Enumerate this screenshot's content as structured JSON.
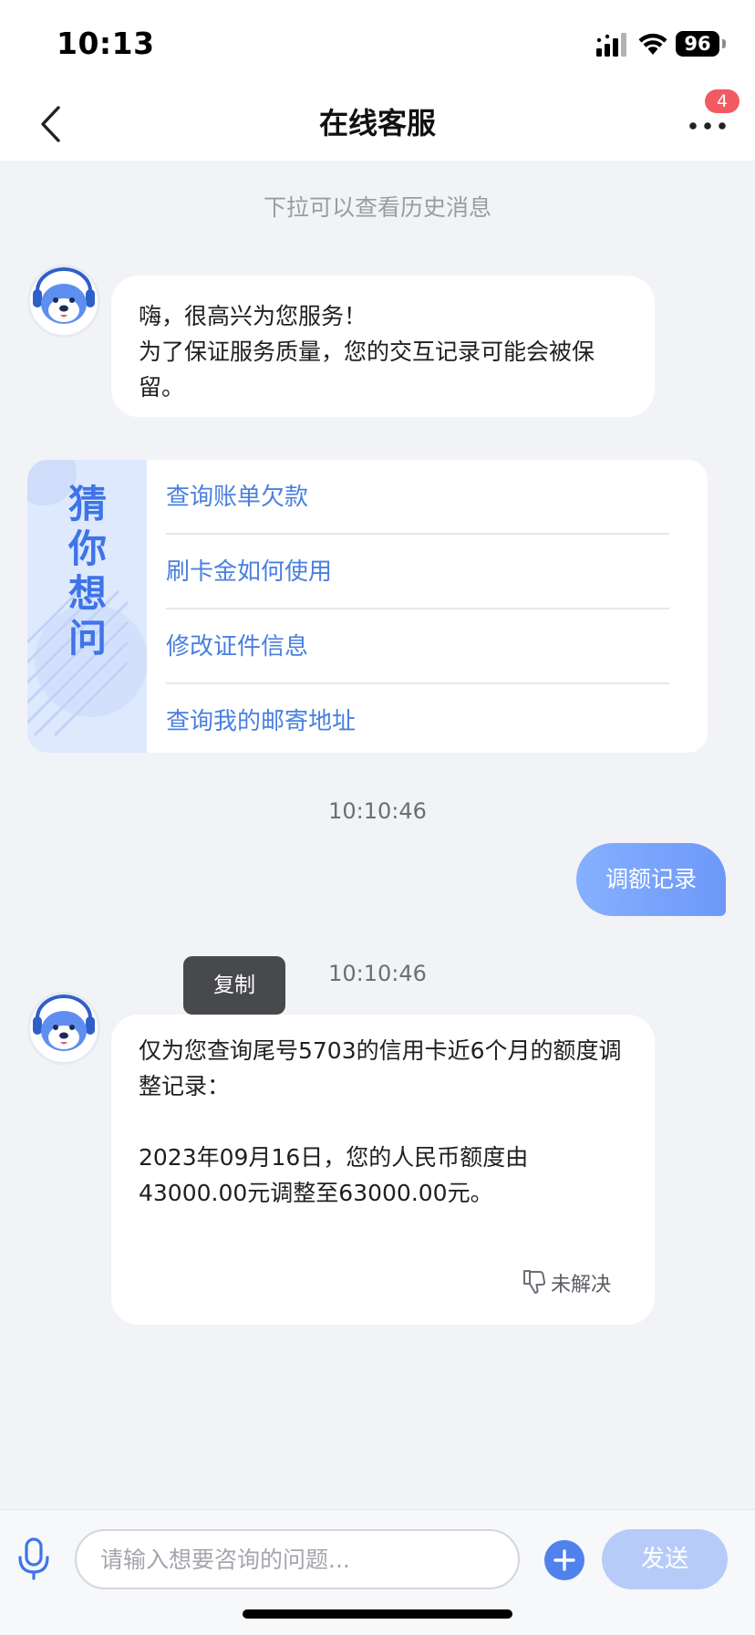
{
  "status_bar": {
    "time": "10:13",
    "battery": "96"
  },
  "header": {
    "title": "在线客服",
    "badge_count": "4"
  },
  "history_hint": "下拉可以查看历史消息",
  "welcome_message": {
    "text": "嗨，很高兴为您服务！\n为了保证服务质量，您的交互记录可能会被保留。"
  },
  "guess": {
    "title": "猜你想问",
    "items": [
      "查询账单欠款",
      "刷卡金如何使用",
      "修改证件信息",
      "查询我的邮寄地址"
    ]
  },
  "timestamps": [
    "10:10:46",
    "10:10:46"
  ],
  "user_message": {
    "text": "调额记录"
  },
  "copy_popup": "复制",
  "reply_message": {
    "text": "仅为您查询尾号5703的信用卡近6个月的额度调整记录：\n\n2023年09月16日，您的人民币额度由43000.00元调整至63000.00元。",
    "unresolved_label": "未解决"
  },
  "input": {
    "placeholder": "请输入想要咨询的问题...",
    "value": ""
  },
  "send_label": "发送",
  "colors": {
    "accent": "#4f82ed",
    "link": "#4a7fe0",
    "badge": "#f25a62",
    "user_bubble": "#7ea6fb"
  },
  "icons": [
    "signal-icon",
    "wifi-icon",
    "battery-icon",
    "back-icon",
    "more-icon",
    "avatar-robot-icon",
    "thumbs-down-icon",
    "mic-icon",
    "plus-icon"
  ]
}
